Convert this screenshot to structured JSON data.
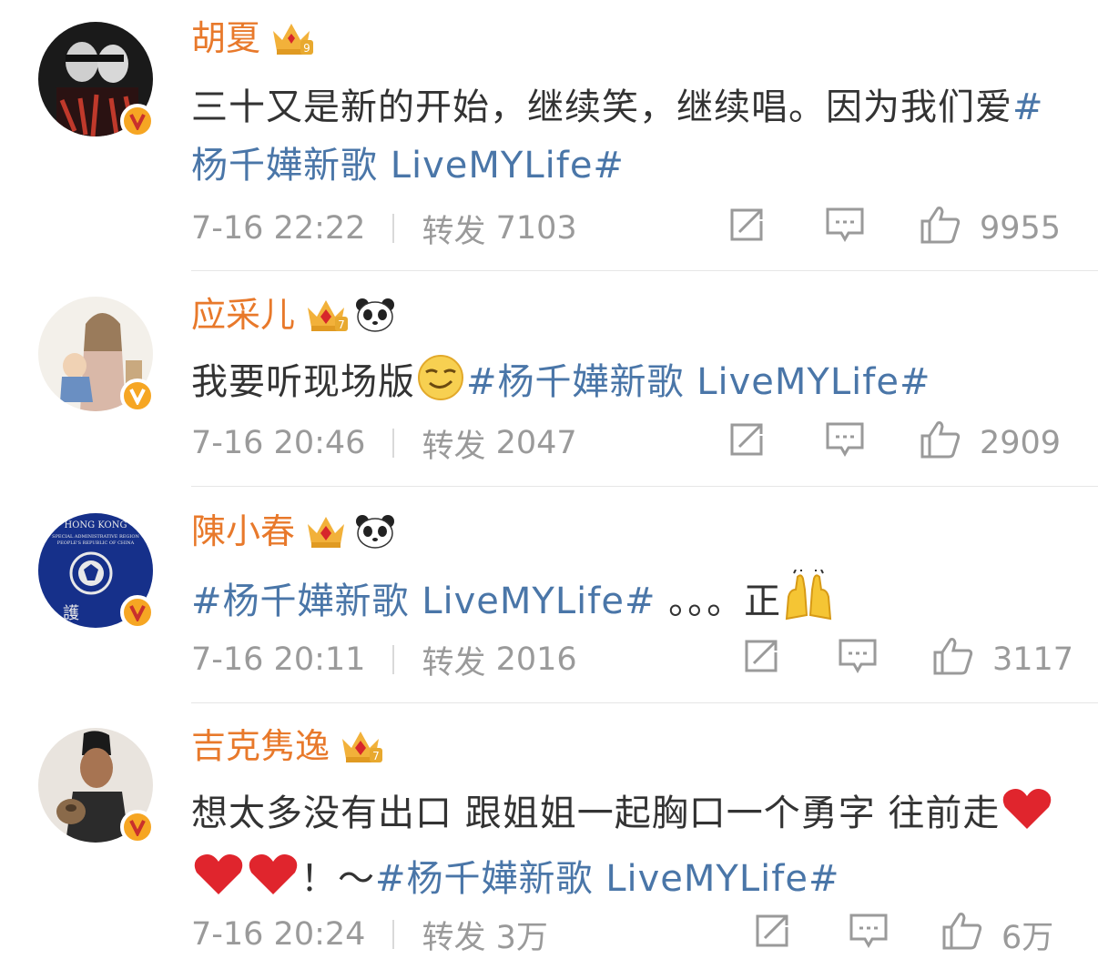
{
  "colors": {
    "username": "#e8792b",
    "topic": "#4a76a8",
    "meta": "#9a9a9a",
    "text": "#333333",
    "verified_badge": "#f6a623"
  },
  "posts": [
    {
      "username": "胡夏",
      "crown_level": "9",
      "has_panda": false,
      "text_before": "三十又是新的开始，继续笑，继续唱。因为我们爱",
      "topic": "#杨千嬅新歌 LiveMYLife#",
      "text_after": "",
      "time": "7-16 22:22",
      "repost_label": "转发",
      "repost_count": "7103",
      "like_count": "9955"
    },
    {
      "username": "应采儿",
      "crown_level": "7",
      "has_panda": true,
      "text_before": "我要听现场版",
      "topic": "#杨千嬅新歌 LiveMYLife#",
      "text_after": "",
      "time": "7-16 20:46",
      "repost_label": "转发",
      "repost_count": "2047",
      "like_count": "2909"
    },
    {
      "username": "陳小春",
      "crown_level": "",
      "has_panda": true,
      "text_before": "",
      "topic": "#杨千嬅新歌 LiveMYLife#",
      "text_after": " 。。。正",
      "time": "7-16 20:11",
      "repost_label": "转发",
      "repost_count": "2016",
      "like_count": "3117"
    },
    {
      "username": "吉克隽逸",
      "crown_level": "7",
      "has_panda": false,
      "text_before": "想太多没有出口 跟姐姐一起胸口一个勇字 往前走",
      "topic": "#杨千嬅新歌 LiveMYLife#",
      "text_mid": "！～",
      "text_after": "",
      "time": "7-16 20:24",
      "repost_label": "转发",
      "repost_count": "3万",
      "like_count": "6万"
    }
  ],
  "avatar3_text": {
    "top": "HONG KONG",
    "line2": "SPECIAL ADMINISTRATIVE REGION",
    "line3": "PEOPLE'S REPUBLIC OF CHINA",
    "char": "護"
  },
  "icons": [
    "repost-icon",
    "comment-icon",
    "like-icon",
    "verified-badge-icon",
    "crown-icon",
    "panda-emoji-icon",
    "heart-emoji-icon",
    "smirk-emoji-icon",
    "raised-hands-emoji-icon"
  ]
}
